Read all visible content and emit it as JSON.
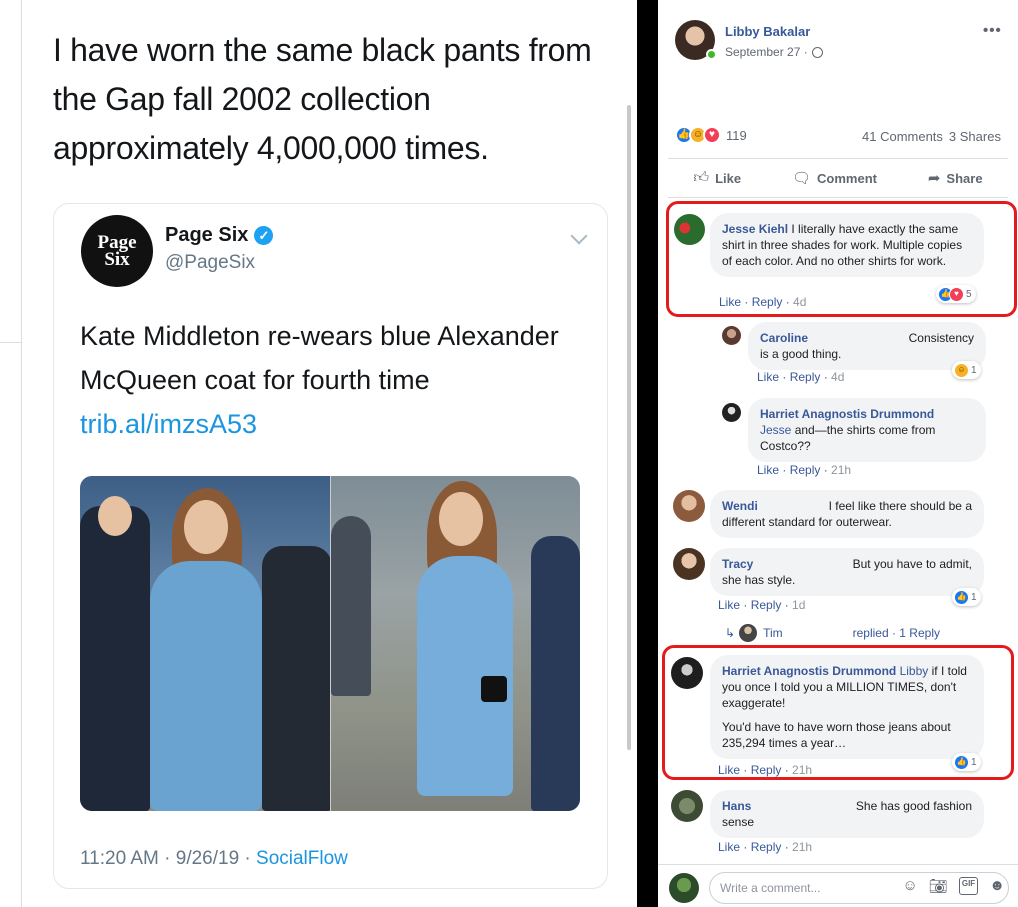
{
  "tweet_screenshot": {
    "quote": "I have worn the same black pants from the Gap fall 2002 collection approximately 4,000,000 times.",
    "author_name": "Page Six",
    "author_handle": "@PageSix",
    "logo_text_line1": "Page",
    "logo_text_line2": "Six",
    "body": "Kate Middleton re-wears blue Alexander McQueen coat for fourth time ",
    "link": "trib.al/imzsA53",
    "meta": "11:20 AM · 9/26/19 · ",
    "source": "SocialFlow"
  },
  "post": {
    "author": "Libby Bakalar",
    "date": "September 27 ·",
    "menu": "•••",
    "reaction_count": "119",
    "comments": "41 Comments",
    "shares": "3 Shares",
    "actions": {
      "like": "Like",
      "comment": "Comment",
      "share": "Share"
    }
  },
  "comments": [
    {
      "name": "Jesse Kiehl",
      "text": " I literally have exactly the same shirt in three shades for work. Multiple copies of each color. And no other shirts for work.",
      "like": "Like",
      "reply": "Reply",
      "time": "4d",
      "reacts": "5"
    },
    {
      "name": "Caroline",
      "text_after": "Consistency",
      "text": "is a good thing.",
      "like": "Like",
      "reply": "Reply",
      "time": "4d",
      "reacts": "1"
    },
    {
      "name": "Harriet Anagnostis Drummond",
      "mention": "Jesse",
      "text": " and—the shirts come from Costco??",
      "like": "Like",
      "reply": "Reply",
      "time": "21h"
    },
    {
      "name": "Wendi",
      "text_after": "I feel like there should be a",
      "text": "different standard for outerwear."
    },
    {
      "name": "Tracy",
      "text_after": "But you have to admit,",
      "text": "she has style.",
      "like": "Like",
      "reply": "Reply",
      "time": "1d",
      "reacts": "1"
    },
    {
      "name": "Harriet Anagnostis Drummond",
      "mention": "Libby",
      "text": " if I told you once I told you a MILLION TIMES, don't exaggerate!",
      "text2": "You'd have to have worn those jeans about 235,294 times a year…",
      "like": "Like",
      "reply": "Reply",
      "time": "21h",
      "reacts": "1"
    },
    {
      "name": "Hans",
      "text_after": "She has good fashion",
      "text": "sense",
      "like": "Like",
      "reply": "Reply",
      "time": "21h"
    }
  ],
  "reply_thread": {
    "name": "Tim",
    "label": "replied · 1 Reply"
  },
  "composer": {
    "placeholder": "Write a comment..."
  },
  "colors": {
    "facebook_blue": "#385898",
    "twitter_blue": "#1b95e0",
    "highlight_red": "#e41a1c"
  }
}
